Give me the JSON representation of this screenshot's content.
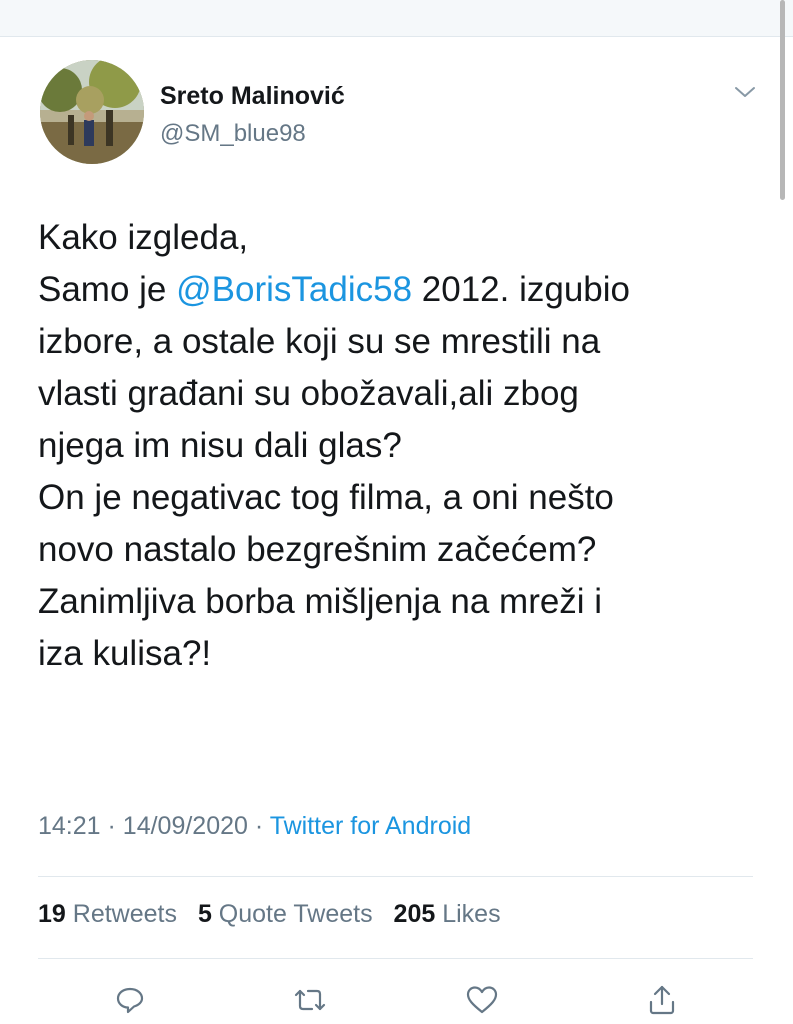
{
  "user": {
    "name": "Sreto Malinović",
    "handle": "@SM_blue98",
    "avatar_icon": "avatar-photo"
  },
  "tweet": {
    "line1": "Kako izgleda,",
    "line2_pre": "Samo je ",
    "mention": "@BorisTadic58",
    "line2_post": " 2012. izgubio",
    "line3": "izbore, a ostale koji su se mrestili na",
    "line4": "vlasti građani su obožavali,ali zbog",
    "line5": "njega im nisu dali glas?",
    "line6": "On je negativac tog filma, a oni nešto",
    "line7": "novo nastalo bezgrešnim začećem?",
    "line8": "Zanimljiva borba mišljenja na mreži i",
    "line9": "iza kulisa?!"
  },
  "meta": {
    "time": "14:21",
    "date": "14/09/2020",
    "separator": "·",
    "source": "Twitter for Android"
  },
  "stats": {
    "retweets_count": "19",
    "retweets_label": "Retweets",
    "quotes_count": "5",
    "quotes_label": "Quote Tweets",
    "likes_count": "205",
    "likes_label": "Likes"
  },
  "colors": {
    "link": "#1b95e0",
    "secondary": "#657786",
    "text": "#14171a"
  }
}
